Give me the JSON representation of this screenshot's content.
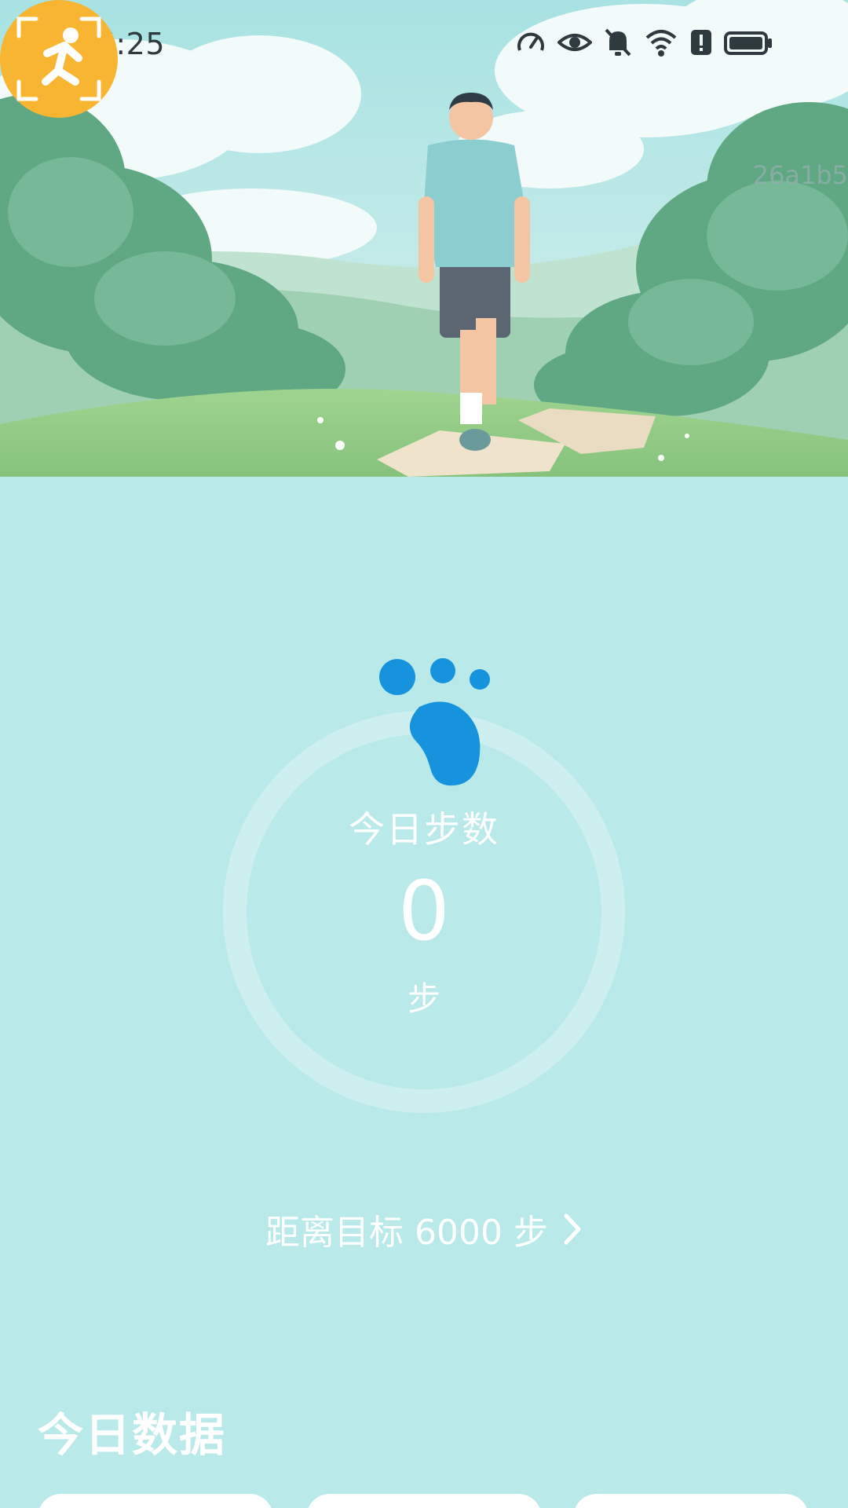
{
  "status_bar": {
    "time": "16:25",
    "icons": [
      "speed-icon",
      "eye-icon",
      "bell-off-icon",
      "wifi-icon",
      "alert-icon",
      "battery-icon"
    ]
  },
  "watermark": "26a1b5",
  "hero": {
    "illustration": "man walking on stepping stones in a green meadow"
  },
  "steps": {
    "title": "今日步数",
    "value": "0",
    "unit": "步",
    "icon": "footprint-icon"
  },
  "goal": {
    "label": "距离目标 6000 步",
    "icon": "chevron-right-icon"
  },
  "today_data": {
    "title": "今日数据"
  },
  "colors": {
    "background": "#b9e9e8",
    "accent": "#1793de",
    "badge": "#f8b531"
  }
}
